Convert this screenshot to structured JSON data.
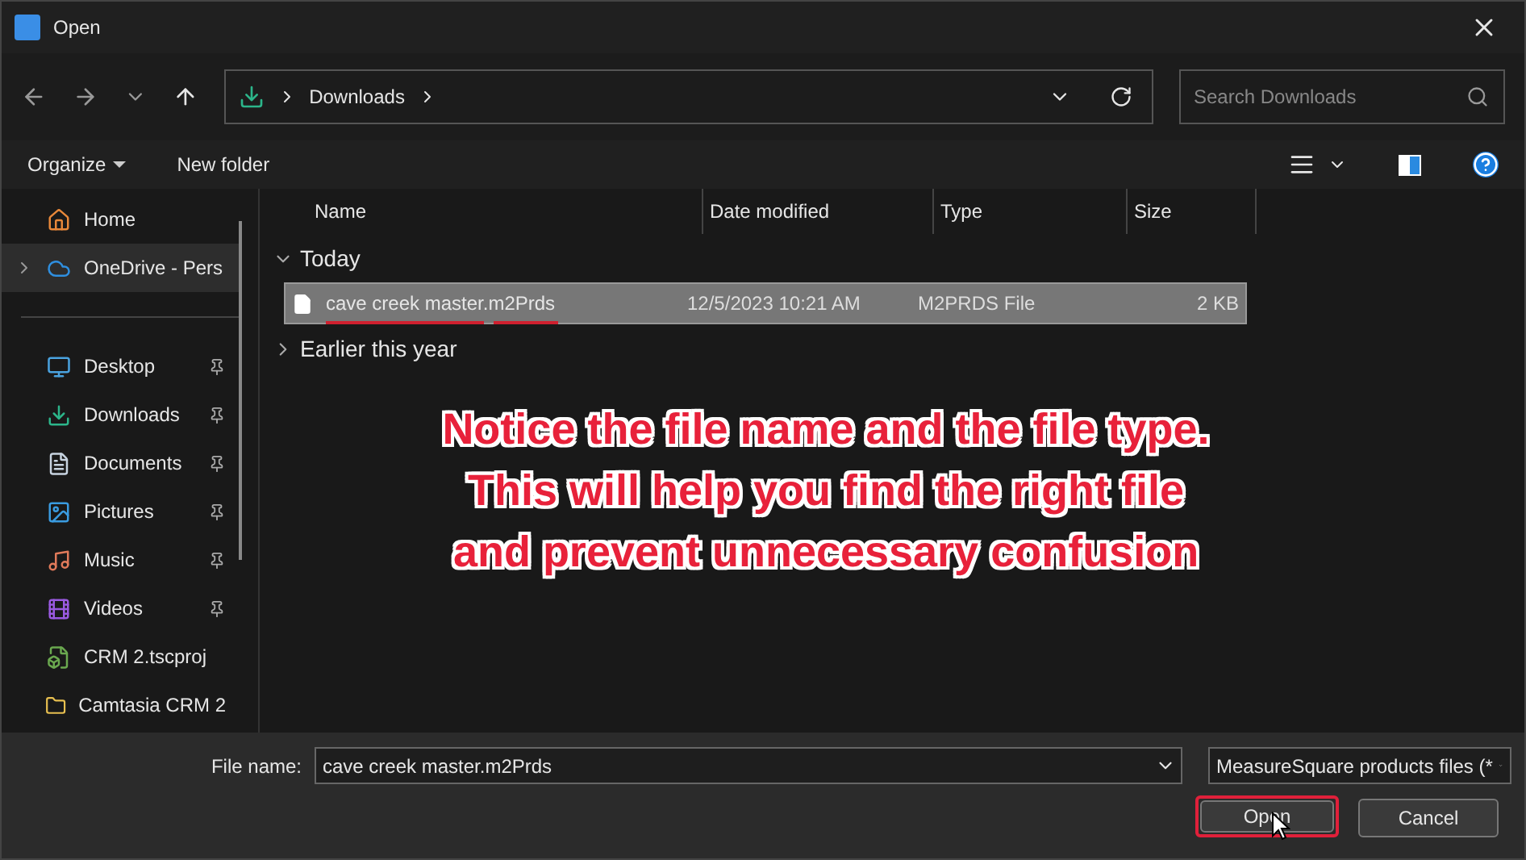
{
  "window": {
    "title": "Open"
  },
  "nav": {
    "path": [
      "Downloads"
    ],
    "search_placeholder": "Search Downloads"
  },
  "toolbar": {
    "organize": "Organize",
    "new_folder": "New folder"
  },
  "sidebar": {
    "items": [
      {
        "label": "Home",
        "kind": "home",
        "pinned": false,
        "selected": false,
        "expandable": false
      },
      {
        "label": "OneDrive - Pers",
        "kind": "cloud",
        "pinned": false,
        "selected": true,
        "expandable": true
      },
      {
        "label": "Desktop",
        "kind": "desktop",
        "pinned": true,
        "selected": false,
        "expandable": false
      },
      {
        "label": "Downloads",
        "kind": "download",
        "pinned": true,
        "selected": false,
        "expandable": false
      },
      {
        "label": "Documents",
        "kind": "document",
        "pinned": true,
        "selected": false,
        "expandable": false
      },
      {
        "label": "Pictures",
        "kind": "pictures",
        "pinned": true,
        "selected": false,
        "expandable": false
      },
      {
        "label": "Music",
        "kind": "music",
        "pinned": true,
        "selected": false,
        "expandable": false
      },
      {
        "label": "Videos",
        "kind": "videos",
        "pinned": true,
        "selected": false,
        "expandable": false
      },
      {
        "label": "CRM 2.tscproj",
        "kind": "project",
        "pinned": false,
        "selected": false,
        "expandable": false
      },
      {
        "label": "Camtasia CRM 2",
        "kind": "folder",
        "pinned": false,
        "selected": false,
        "expandable": false
      }
    ]
  },
  "columns": [
    "Name",
    "Date modified",
    "Type",
    "Size"
  ],
  "groups": [
    {
      "label": "Today",
      "expanded": true,
      "files": [
        {
          "name": "cave creek master.m2Prds",
          "date": "12/5/2023 10:21 AM",
          "type": "M2PRDS File",
          "size": "2 KB",
          "selected": true
        }
      ]
    },
    {
      "label": "Earlier this year",
      "expanded": false
    }
  ],
  "annotation": "Notice the file name and the file type. This will help you find the right file and prevent unnecessary confusion",
  "footer": {
    "file_name_label": "File name:",
    "file_name": "cave creek master.m2Prds",
    "filter": "MeasureSquare products files (*",
    "open": "Open",
    "cancel": "Cancel"
  }
}
